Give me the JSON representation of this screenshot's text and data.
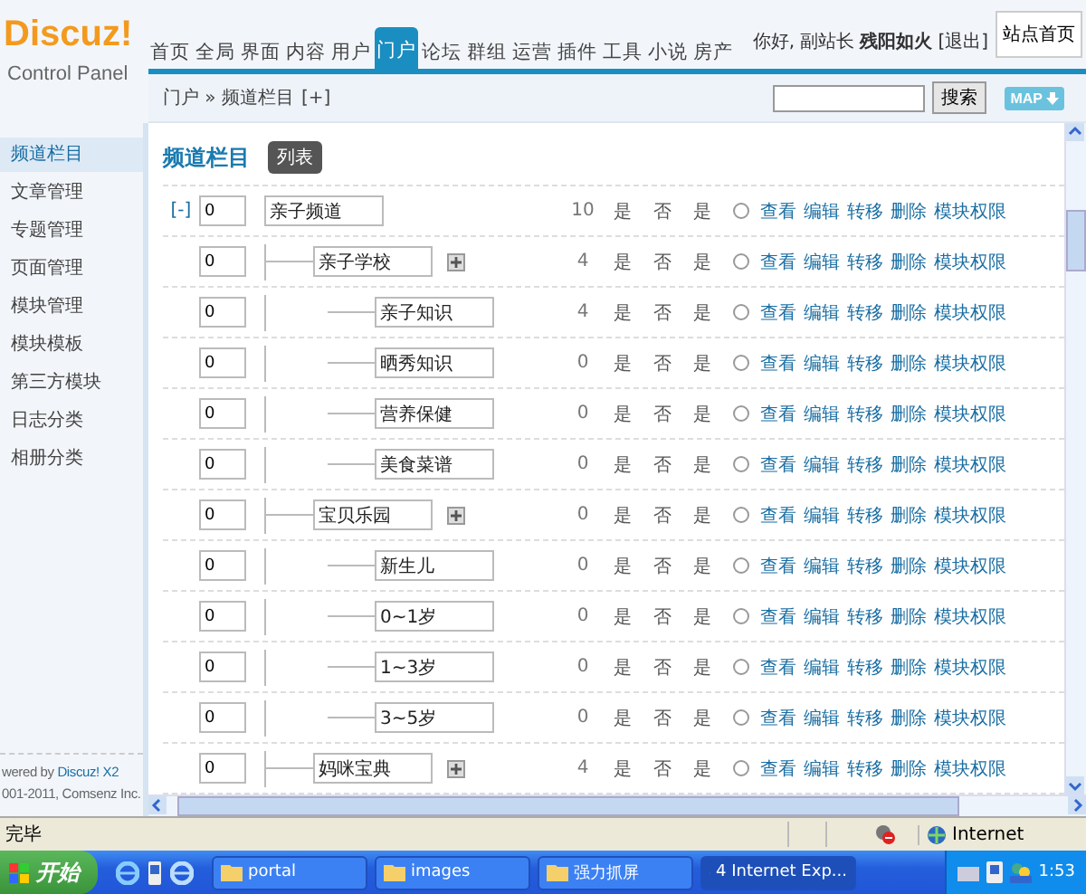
{
  "header": {
    "logo": "Discuz!",
    "logo_sub": "Control Panel",
    "nav": [
      {
        "label": "首页",
        "selected": false
      },
      {
        "label": "全局",
        "selected": false
      },
      {
        "label": "界面",
        "selected": false
      },
      {
        "label": "内容",
        "selected": false
      },
      {
        "label": "用户",
        "selected": false
      },
      {
        "label": "门户",
        "selected": true
      },
      {
        "label": "论坛",
        "selected": false
      },
      {
        "label": "群组",
        "selected": false
      },
      {
        "label": "运营",
        "selected": false
      },
      {
        "label": "插件",
        "selected": false
      },
      {
        "label": "工具",
        "selected": false
      },
      {
        "label": "小说",
        "selected": false
      },
      {
        "label": "房产",
        "selected": false
      }
    ],
    "greeting": "你好, 副站长",
    "user": "残阳如火",
    "logout": "[退出]",
    "home_button": "站点首页"
  },
  "breadcrumb": {
    "path": "门户 » 频道栏目",
    "add": "[+]",
    "search_button": "搜索",
    "map_button": "MAP"
  },
  "sidebar": {
    "items": [
      {
        "label": "频道栏目",
        "selected": true
      },
      {
        "label": "文章管理",
        "selected": false
      },
      {
        "label": "专题管理",
        "selected": false
      },
      {
        "label": "页面管理",
        "selected": false
      },
      {
        "label": "模块管理",
        "selected": false
      },
      {
        "label": "模块模板",
        "selected": false
      },
      {
        "label": "第三方模块",
        "selected": false
      },
      {
        "label": "日志分类",
        "selected": false
      },
      {
        "label": "相册分类",
        "selected": false
      }
    ],
    "powered": "wered by",
    "powered_link": "Discuz! X2",
    "copyright": "001-2011, Comsenz Inc."
  },
  "content": {
    "title": "频道栏目",
    "tab": "列表",
    "rows": [
      {
        "toggle": "[-]",
        "order": "0",
        "name": "亲子频道",
        "column_3": "10",
        "column_4": "是",
        "column_5": "否",
        "column_6": "是",
        "selected": false,
        "actions": [
          "查看",
          "编辑",
          "转移",
          "删除",
          "模块权限"
        ],
        "children": [
          {
            "order": "0",
            "name": "亲子学校",
            "add_child": true,
            "column_3": "4",
            "column_4": "是",
            "column_5": "否",
            "column_6": "是",
            "selected": false,
            "actions": [
              "查看",
              "编辑",
              "转移",
              "删除",
              "模块权限"
            ],
            "children": [
              {
                "order": "0",
                "name": "亲子知识",
                "column_3": "4",
                "column_4": "是",
                "column_5": "否",
                "column_6": "是",
                "selected": false,
                "actions": [
                  "查看",
                  "编辑",
                  "转移",
                  "删除",
                  "模块权限"
                ]
              },
              {
                "order": "0",
                "name": "晒秀知识",
                "column_3": "0",
                "column_4": "是",
                "column_5": "否",
                "column_6": "是",
                "selected": false,
                "actions": [
                  "查看",
                  "编辑",
                  "转移",
                  "删除",
                  "模块权限"
                ]
              },
              {
                "order": "0",
                "name": "营养保健",
                "column_3": "0",
                "column_4": "是",
                "column_5": "否",
                "column_6": "是",
                "selected": false,
                "actions": [
                  "查看",
                  "编辑",
                  "转移",
                  "删除",
                  "模块权限"
                ]
              },
              {
                "order": "0",
                "name": "美食菜谱",
                "column_3": "0",
                "column_4": "是",
                "column_5": "否",
                "column_6": "是",
                "selected": false,
                "actions": [
                  "查看",
                  "编辑",
                  "转移",
                  "删除",
                  "模块权限"
                ]
              }
            ]
          },
          {
            "order": "0",
            "name": "宝贝乐园",
            "add_child": true,
            "column_3": "0",
            "column_4": "是",
            "column_5": "否",
            "column_6": "是",
            "selected": false,
            "actions": [
              "查看",
              "编辑",
              "转移",
              "删除",
              "模块权限"
            ],
            "children": [
              {
                "order": "0",
                "name": "新生儿",
                "column_3": "0",
                "column_4": "是",
                "column_5": "否",
                "column_6": "是",
                "selected": false,
                "actions": [
                  "查看",
                  "编辑",
                  "转移",
                  "删除",
                  "模块权限"
                ]
              },
              {
                "order": "0",
                "name": "0~1岁",
                "column_3": "0",
                "column_4": "是",
                "column_5": "否",
                "column_6": "是",
                "selected": false,
                "actions": [
                  "查看",
                  "编辑",
                  "转移",
                  "删除",
                  "模块权限"
                ]
              },
              {
                "order": "0",
                "name": "1~3岁",
                "column_3": "0",
                "column_4": "是",
                "column_5": "否",
                "column_6": "是",
                "selected": false,
                "actions": [
                  "查看",
                  "编辑",
                  "转移",
                  "删除",
                  "模块权限"
                ]
              },
              {
                "order": "0",
                "name": "3~5岁",
                "column_3": "0",
                "column_4": "是",
                "column_5": "否",
                "column_6": "是",
                "selected": false,
                "actions": [
                  "查看",
                  "编辑",
                  "转移",
                  "删除",
                  "模块权限"
                ]
              }
            ]
          },
          {
            "order": "0",
            "name": "妈咪宝典",
            "add_child": true,
            "column_3": "4",
            "column_4": "是",
            "column_5": "否",
            "column_6": "是",
            "selected": false,
            "actions": [
              "查看",
              "编辑",
              "转移",
              "删除",
              "模块权限"
            ]
          }
        ]
      }
    ]
  },
  "status_bar": {
    "text": "完毕",
    "zone": "Internet"
  },
  "taskbar": {
    "start": "开始",
    "windows": [
      {
        "label": "portal",
        "selected": false
      },
      {
        "label": "images",
        "selected": false
      },
      {
        "label": "强力抓屏",
        "selected": false
      },
      {
        "label": "4 Internet Exp...",
        "selected": true
      }
    ],
    "clock": "1:53"
  }
}
